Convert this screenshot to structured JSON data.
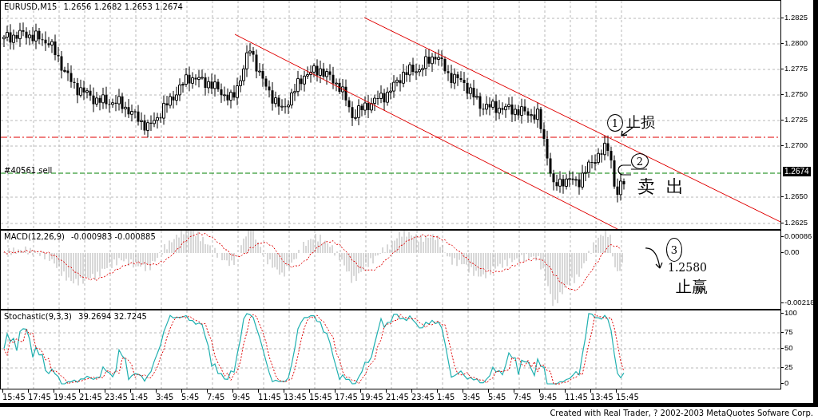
{
  "chart": {
    "title": "EURUSD,M15",
    "quote": "1.2656 1.2682 1.2653 1.2674",
    "order_label": "#40561 sell",
    "current_price": "1.2674",
    "price_axis": [
      "1.2825",
      "1.2800",
      "1.2775",
      "1.2750",
      "1.2725",
      "1.2700",
      "1.2650",
      "1.2625"
    ]
  },
  "macd": {
    "title": "MACD(12,26,9)",
    "values": "-0.000983  -0.000885",
    "axis": [
      "0.00086",
      "0.00",
      "-0.00218"
    ]
  },
  "stochastic": {
    "title": "Stochastic(9,3,3)",
    "values": "39.2694  32.7245",
    "axis": [
      "100",
      "75",
      "50",
      "25",
      "0"
    ]
  },
  "time_axis": [
    "15:45",
    "17:45",
    "19:45",
    "21:45",
    "23:45",
    "1:45",
    "3:45",
    "5:45",
    "7:45",
    "9:45",
    "11:45",
    "13:45",
    "15:45",
    "17:45",
    "19:45",
    "21:45",
    "23:45",
    "1:45",
    "3:45",
    "5:45",
    "7:45",
    "9:45",
    "11:45",
    "13:45",
    "15:45"
  ],
  "annotations": [
    {
      "number": "1",
      "text": "止损"
    },
    {
      "number": "2",
      "text": "卖出"
    },
    {
      "number": "3",
      "text": "1.2580",
      "note": "止赢"
    }
  ],
  "footer": "Created with Real Trader, ? 2002-2003 MetaQuotes Sofware Corp."
}
